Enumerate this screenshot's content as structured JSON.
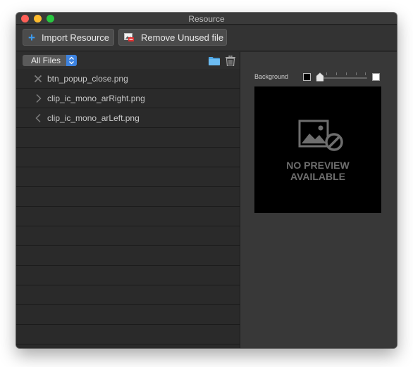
{
  "window": {
    "title": "Resource"
  },
  "toolbar": {
    "import_label": "Import Resource",
    "remove_label": "Remove Unused file"
  },
  "file_list": {
    "filter_value": "All Files",
    "items": [
      {
        "name": "btn_popup_close.png",
        "icon": "close-x-icon"
      },
      {
        "name": "clip_ic_mono_arRight.png",
        "icon": "chevron-right-icon"
      },
      {
        "name": "clip_ic_mono_arLeft.png",
        "icon": "chevron-left-icon"
      }
    ],
    "empty_row_count": 11
  },
  "preview": {
    "background_label": "Background",
    "background_level": 0,
    "no_preview_line1": "NO PREVIEW",
    "no_preview_line2": "AVAILABLE"
  },
  "colors": {
    "accent_blue": "#3d83e0",
    "traffic_close": "#ff5f57",
    "traffic_minimize": "#febc2e",
    "traffic_maximize": "#28c840"
  }
}
